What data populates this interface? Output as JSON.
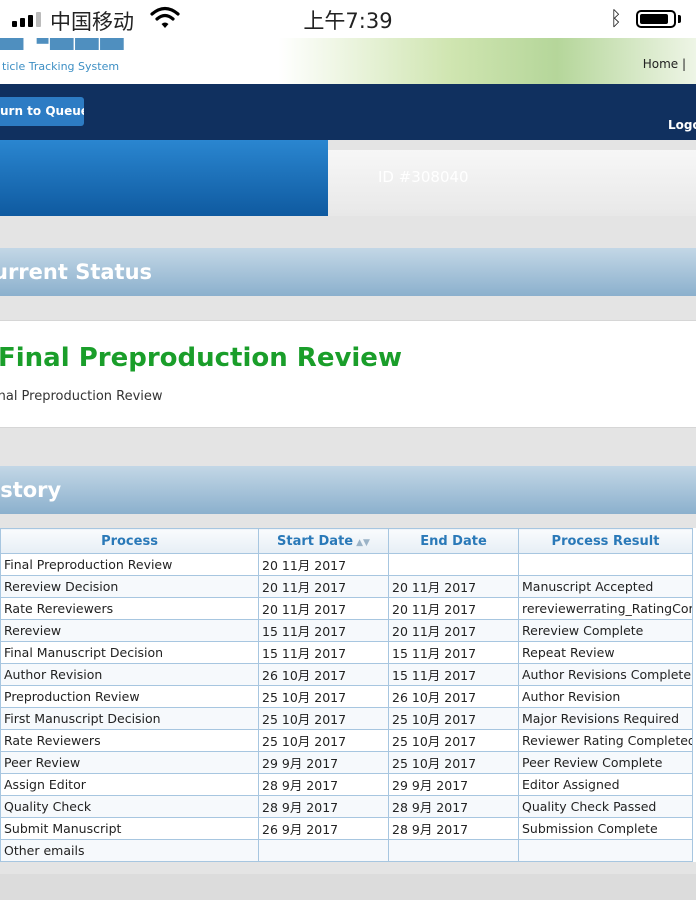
{
  "status_bar": {
    "carrier": "中国移动",
    "time": "上午7:39",
    "icons": [
      "signal-icon",
      "wifi-icon",
      "bluetooth-icon",
      "battery-icon"
    ]
  },
  "header": {
    "tagline": "ticle Tracking System",
    "home_link": "Home  |"
  },
  "nav": {
    "return_button": "urn to Queue",
    "logout": "Logo"
  },
  "manuscript": {
    "id_label": "ID #308040"
  },
  "current_status": {
    "heading": "urrent Status",
    "title": "Final Preproduction Review",
    "subtitle": "inal Preproduction Review"
  },
  "history": {
    "heading": "istory",
    "columns": [
      "Process",
      "Start Date",
      "End Date",
      "Process Result"
    ],
    "rows": [
      [
        "Final Preproduction Review",
        "20 11月 2017",
        "",
        ""
      ],
      [
        "Rereview Decision",
        "20 11月 2017",
        "20 11月 2017",
        "Manuscript Accepted"
      ],
      [
        "Rate Rereviewers",
        "20 11月 2017",
        "20 11月 2017",
        "rereviewerrating_RatingComp"
      ],
      [
        "Rereview",
        "15 11月 2017",
        "20 11月 2017",
        "Rereview Complete"
      ],
      [
        "Final Manuscript Decision",
        "15 11月 2017",
        "15 11月 2017",
        "Repeat Review"
      ],
      [
        "Author Revision",
        "26 10月 2017",
        "15 11月 2017",
        "Author Revisions Complete"
      ],
      [
        "Preproduction Review",
        "25 10月 2017",
        "26 10月 2017",
        "Author Revision"
      ],
      [
        "First Manuscript Decision",
        "25 10月 2017",
        "25 10月 2017",
        "Major Revisions Required"
      ],
      [
        "Rate Reviewers",
        "25 10月 2017",
        "25 10月 2017",
        "Reviewer Rating Completed"
      ],
      [
        "Peer Review",
        "29 9月 2017",
        "25 10月 2017",
        "Peer Review Complete"
      ],
      [
        "Assign Editor",
        "28 9月 2017",
        "29 9月 2017",
        "Editor Assigned"
      ],
      [
        "Quality Check",
        "28 9月 2017",
        "28 9月 2017",
        "Quality Check Passed"
      ],
      [
        "Submit Manuscript",
        "26 9月 2017",
        "28 9月 2017",
        "Submission Complete"
      ],
      [
        "Other emails",
        "",
        "",
        ""
      ]
    ]
  },
  "colors": {
    "navbar": "#10305f",
    "accent_blue": "#2d7cc4",
    "status_green": "#1a9e2a",
    "section_bar": "#8bb0cd",
    "table_header_text": "#2a79b8"
  }
}
